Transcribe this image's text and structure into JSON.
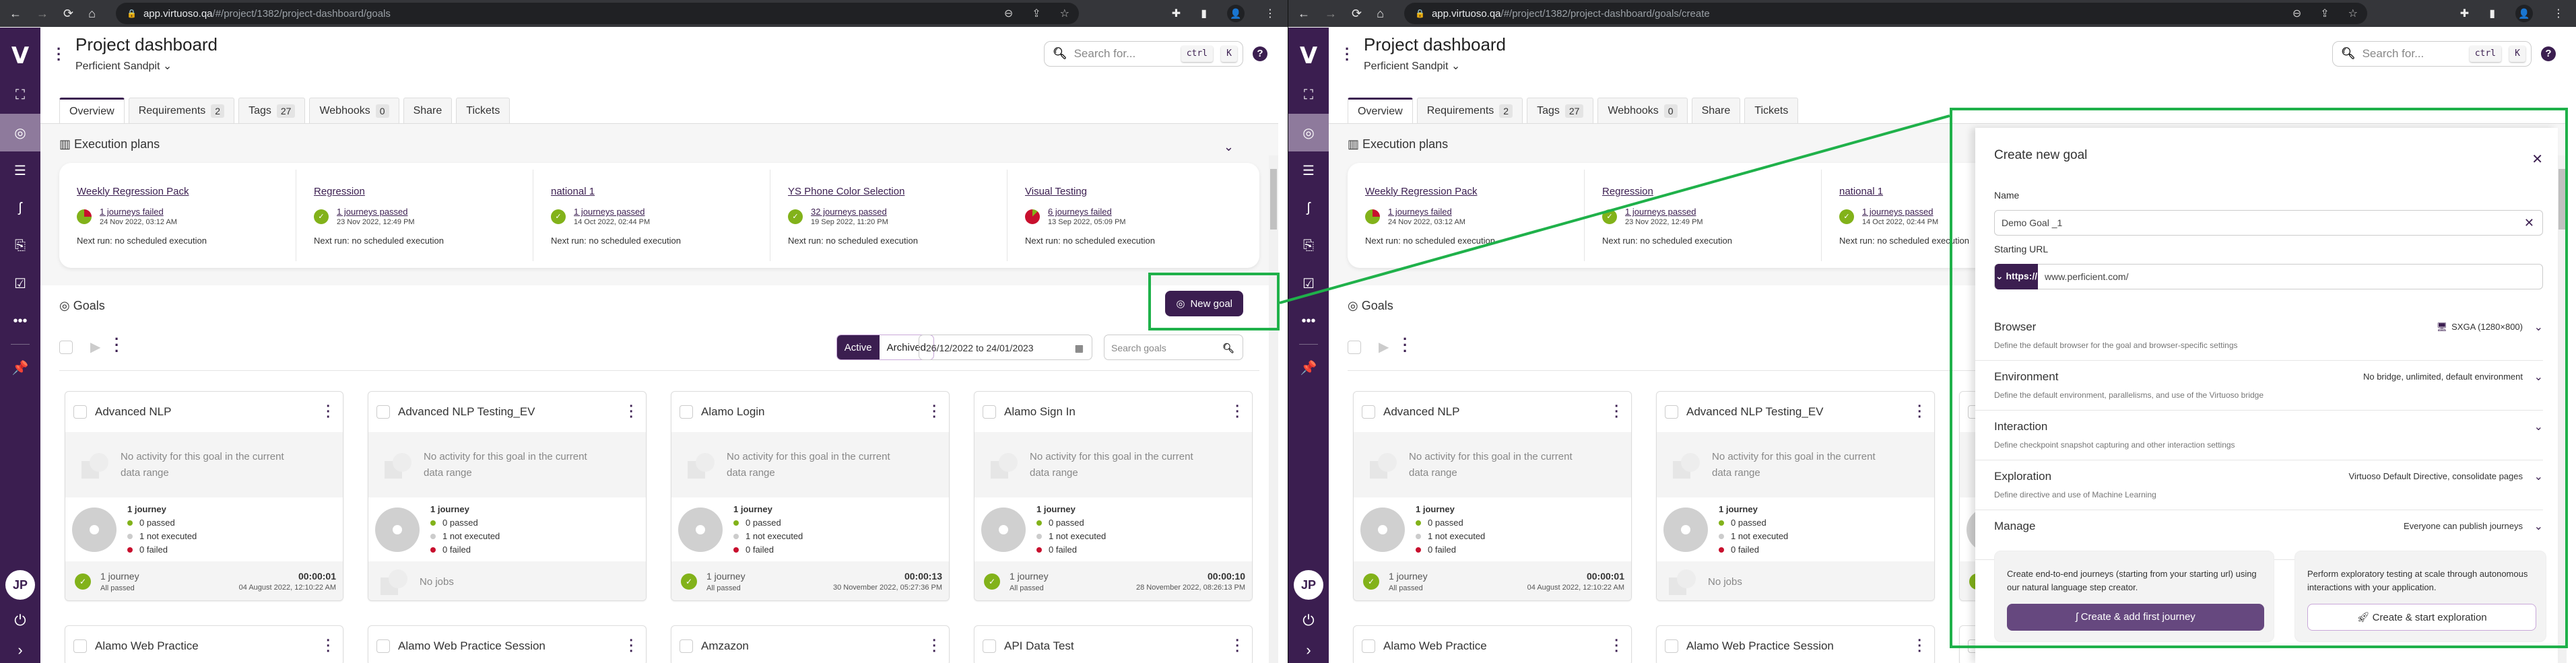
{
  "panes": [
    {
      "id": "left",
      "browser": {
        "url_host": "app.virtuoso.qa",
        "url_path": "/#/project/1382/project-dashboard/goals"
      }
    },
    {
      "id": "right",
      "browser": {
        "url_host": "app.virtuoso.qa",
        "url_path": "/#/project/1382/project-dashboard/goals/create"
      }
    }
  ],
  "app": {
    "logo": "V",
    "user_initials": "JP",
    "header": {
      "title": "Project dashboard",
      "project": "Perficient Sandpit",
      "search_placeholder": "Search for...",
      "kbd_ctrl": "ctrl",
      "kbd_k": "K",
      "help": "?"
    },
    "tabs": [
      {
        "label": "Overview",
        "badge": null,
        "active": true
      },
      {
        "label": "Requirements",
        "badge": "2"
      },
      {
        "label": "Tags",
        "badge": "27"
      },
      {
        "label": "Webhooks",
        "badge": "0"
      },
      {
        "label": "Share",
        "badge": null
      },
      {
        "label": "Tickets",
        "badge": null
      }
    ],
    "execution_plans": {
      "title": "Execution plans",
      "plans": [
        {
          "name": "Weekly Regression Pack",
          "status": "1 journeys failed",
          "date": "24 Nov 2022, 03:12 AM",
          "next": "Next run: no scheduled execution",
          "state": "failed-partial"
        },
        {
          "name": "Regression",
          "status": "1 journeys passed",
          "date": "23 Nov 2022, 12:49 PM",
          "next": "Next run: no scheduled execution",
          "state": "passed"
        },
        {
          "name": "national 1",
          "status": "1 journeys passed",
          "date": "14 Oct 2022, 02:44 PM",
          "next": "Next run: no scheduled execution",
          "state": "passed"
        },
        {
          "name": "YS Phone Color Selection",
          "status": "32 journeys passed",
          "date": "19 Sep 2022, 11:20 PM",
          "next": "Next run: no scheduled execution",
          "state": "passed"
        },
        {
          "name": "Visual Testing",
          "status": "6 journeys failed",
          "date": "13 Sep 2022, 05:09 PM",
          "next": "Next run: no scheduled execution",
          "state": "failed"
        }
      ]
    },
    "goals": {
      "title": "Goals",
      "new_goal_label": "New goal",
      "filter_active": "Active",
      "filter_archived": "Archived",
      "date_range": "26/12/2022 to 24/01/2023",
      "search_placeholder": "Search goals",
      "no_activity_text": "No activity for this goal in the current data range",
      "cards": [
        {
          "name": "Advanced NLP",
          "journeys": "1 journey",
          "passed": "0 passed",
          "not_executed": "1 not executed",
          "failed": "0 failed",
          "job_title": "1 journey",
          "job_sub": "All passed",
          "duration": "00:00:01",
          "job_date": "04 August 2022, 12:10:22 AM"
        },
        {
          "name": "Advanced NLP Testing_EV",
          "journeys": "1 journey",
          "passed": "0 passed",
          "not_executed": "1 not executed",
          "failed": "0 failed",
          "no_jobs": "No jobs"
        },
        {
          "name": "Alamo Login",
          "journeys": "1 journey",
          "passed": "0 passed",
          "not_executed": "1 not executed",
          "failed": "0 failed",
          "job_title": "1 journey",
          "job_sub": "All passed",
          "duration": "00:00:13",
          "job_date": "30 November 2022, 05:27:36 PM"
        },
        {
          "name": "Alamo Sign In",
          "journeys": "1 journey",
          "passed": "0 passed",
          "not_executed": "1 not executed",
          "failed": "0 failed",
          "job_title": "1 journey",
          "job_sub": "All passed",
          "duration": "00:00:10",
          "job_date": "28 November 2022, 08:26:13 PM"
        }
      ],
      "second_row": [
        "Alamo Web Practice",
        "Alamo Web Practice Session",
        "Amzazon",
        "API Data Test"
      ]
    }
  },
  "modal": {
    "title": "Create new goal",
    "name_label": "Name",
    "name_value": "Demo Goal _1",
    "url_label": "Starting URL",
    "protocol": "https://",
    "url_value": "www.perficient.com/",
    "sections": [
      {
        "title": "Browser",
        "desc": "Define the default browser for the goal and browser-specific settings",
        "value": "SXGA (1280×800)"
      },
      {
        "title": "Environment",
        "desc": "Define the default environment, parallelisms, and use of the Virtuoso bridge",
        "value": "No bridge, unlimited, default environment"
      },
      {
        "title": "Interaction",
        "desc": "Define checkpoint snapshot capturing and other interaction settings",
        "value": ""
      },
      {
        "title": "Exploration",
        "desc": "Define directive and use of Machine Learning",
        "value": "Virtuoso Default Directive, consolidate pages"
      },
      {
        "title": "Manage",
        "desc": "",
        "value": "Everyone can publish journeys"
      }
    ],
    "cta_journey_text": "Create end-to-end journeys (starting from your starting url) using our natural language step creator.",
    "cta_journey_button": "Create & add first journey",
    "cta_explore_text": "Perform exploratory testing at scale through autonomous interactions with your application.",
    "cta_explore_button": "Create & start exploration"
  },
  "colors": {
    "brand": "#3b1e50",
    "passed": "#82b21a",
    "failed": "#c8102e",
    "not_executed": "#cccccc",
    "annotation": "#1fb14a"
  }
}
